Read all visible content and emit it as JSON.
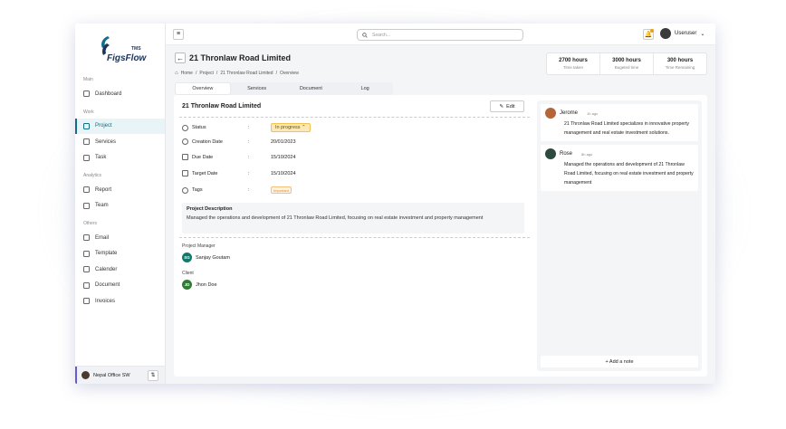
{
  "brand": {
    "name": "FigsFlow",
    "tag": "TMS"
  },
  "sidebar": {
    "sections": [
      {
        "label": "Main",
        "items": [
          {
            "label": "Dashboard"
          }
        ]
      },
      {
        "label": "Work",
        "items": [
          {
            "label": "Project",
            "active": true
          },
          {
            "label": "Services"
          },
          {
            "label": "Task"
          }
        ]
      },
      {
        "label": "Analytics",
        "items": [
          {
            "label": "Report"
          },
          {
            "label": "Team"
          }
        ]
      },
      {
        "label": "Others",
        "items": [
          {
            "label": "Email"
          },
          {
            "label": "Template"
          },
          {
            "label": "Calender"
          },
          {
            "label": "Document"
          },
          {
            "label": "Invoices"
          }
        ]
      }
    ],
    "office": "Nepal Office SW"
  },
  "topbar": {
    "search_placeholder": "Search...",
    "user": "Useruser"
  },
  "header": {
    "title": "21 Thronlaw Road Limited",
    "breadcrumb": [
      "Home",
      "Project",
      "21 Thronlaw Road Limited",
      "Overview"
    ],
    "stats": [
      {
        "value": "2700 hours",
        "label": "Time taken"
      },
      {
        "value": "3000 hours",
        "label": "Bugeted time"
      },
      {
        "value": "300 hours",
        "label": "Time Remaining"
      }
    ],
    "tabs": [
      {
        "label": "Overview",
        "active": true
      },
      {
        "label": "Services"
      },
      {
        "label": "Document"
      },
      {
        "label": "Log"
      }
    ]
  },
  "project": {
    "title": "21 Thronlaw Road Limited",
    "edit_label": "Edit",
    "fields": {
      "status": {
        "label": "Status",
        "value": "In progress"
      },
      "creation": {
        "label": "Creation Date",
        "value": "20/01/2023"
      },
      "due": {
        "label": "Due Date",
        "value": "15/10/2024"
      },
      "target": {
        "label": "Target Date",
        "value": "15/10/2024"
      },
      "tags": {
        "label": "Tags",
        "value": "Important"
      }
    },
    "description": {
      "heading": "Project Description",
      "text": "Managed the operations and development of 21 Thronlaw Road Limited, focusing on real estate investment and property management"
    },
    "manager": {
      "label": "Project Manager",
      "initials": "SG",
      "name": "Sanjay Goutam"
    },
    "client": {
      "label": "Client",
      "initials": "JD",
      "name": "Jhon Doe"
    }
  },
  "notes": [
    {
      "author": "Jerome",
      "time": "1h ago",
      "text": "21 Thronlaw Road Limited specializes in innovative property management and real estate investment solutions."
    },
    {
      "author": "Rose",
      "time": "8h ago",
      "text": "Managed the operations and development of 21 Thronlaw Road Limited, focusing on real estate investment and property management"
    }
  ],
  "add_note_label": "+ Add a note",
  "colors": {
    "accent": "#0e6e8c",
    "progress_bg": "#fde9b8",
    "manager": "#0e7a6b",
    "client": "#2e7d32"
  }
}
